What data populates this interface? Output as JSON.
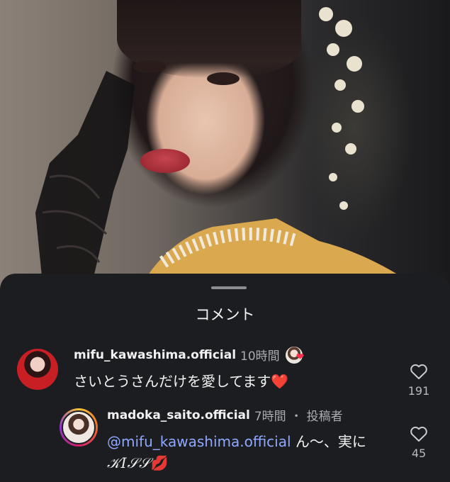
{
  "sheet": {
    "title": "コメント"
  },
  "comments": [
    {
      "username": "mifu_kawashima.official",
      "time": "10時間",
      "text_before": "さいとうさんだけを愛してます",
      "text_emoji": "❤️",
      "like_count": "191",
      "liked_by_author_heart": "❤"
    },
    {
      "username": "madoka_saito.official",
      "time": "7時間",
      "separator": "・",
      "author_tag": "投稿者",
      "mention": "@mifu_kawashima.official",
      "text_after": " ん〜、実に",
      "text_line2": "𝒦𝐼𝒮𝒮",
      "text_line2_emoji": "💋",
      "like_count": "45"
    }
  ],
  "icons": {
    "heart": "heart-outline-icon",
    "avatar": "avatar"
  },
  "colors": {
    "sheet_bg": "#1b1d20",
    "mention": "#8fa8ff",
    "muted": "#a9acb1"
  }
}
